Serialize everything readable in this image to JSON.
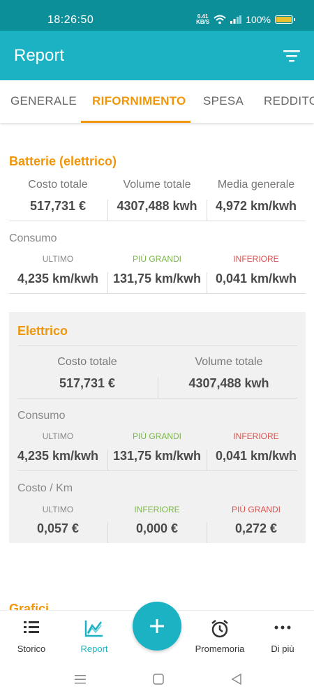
{
  "status": {
    "time": "18:26:50",
    "speed_value": "0.41",
    "speed_unit": "KB/S",
    "battery": "100%"
  },
  "appbar": {
    "title": "Report"
  },
  "tabs": [
    "GENERALE",
    "RIFORNIMENTO",
    "SPESA",
    "REDDITO"
  ],
  "batterie": {
    "title": "Batterie (elettrico)",
    "labels": [
      "Costo totale",
      "Volume totale",
      "Media generale"
    ],
    "values": [
      "517,731 €",
      "4307,488 kwh",
      "4,972 km/kwh"
    ],
    "consumo": {
      "title": "Consumo",
      "labels": [
        "ULTIMO",
        "PIÙ GRANDI",
        "INFERIORE"
      ],
      "values": [
        "4,235 km/kwh",
        "131,75 km/kwh",
        "0,041 km/kwh"
      ]
    }
  },
  "elettrico": {
    "title": "Elettrico",
    "labels": [
      "Costo totale",
      "Volume totale"
    ],
    "values": [
      "517,731 €",
      "4307,488 kwh"
    ],
    "consumo": {
      "title": "Consumo",
      "labels": [
        "ULTIMO",
        "PIÙ GRANDI",
        "INFERIORE"
      ],
      "values": [
        "4,235 km/kwh",
        "131,75 km/kwh",
        "0,041 km/kwh"
      ]
    },
    "costo_km": {
      "title": "Costo / Km",
      "labels": [
        "ULTIMO",
        "INFERIORE",
        "PIÙ GRANDI"
      ],
      "values": [
        "0,057 €",
        "0,000 €",
        "0,272 €"
      ]
    }
  },
  "grafici": {
    "title": "Grafici"
  },
  "nav": {
    "storico": "Storico",
    "report": "Report",
    "promemoria": "Promemoria",
    "di_piu": "Di più"
  },
  "colors": {
    "accent": "#1bb3c3",
    "status_bar": "#0d8f99",
    "orange": "#f0960a",
    "green": "#7ab648",
    "red": "#d9534f"
  }
}
